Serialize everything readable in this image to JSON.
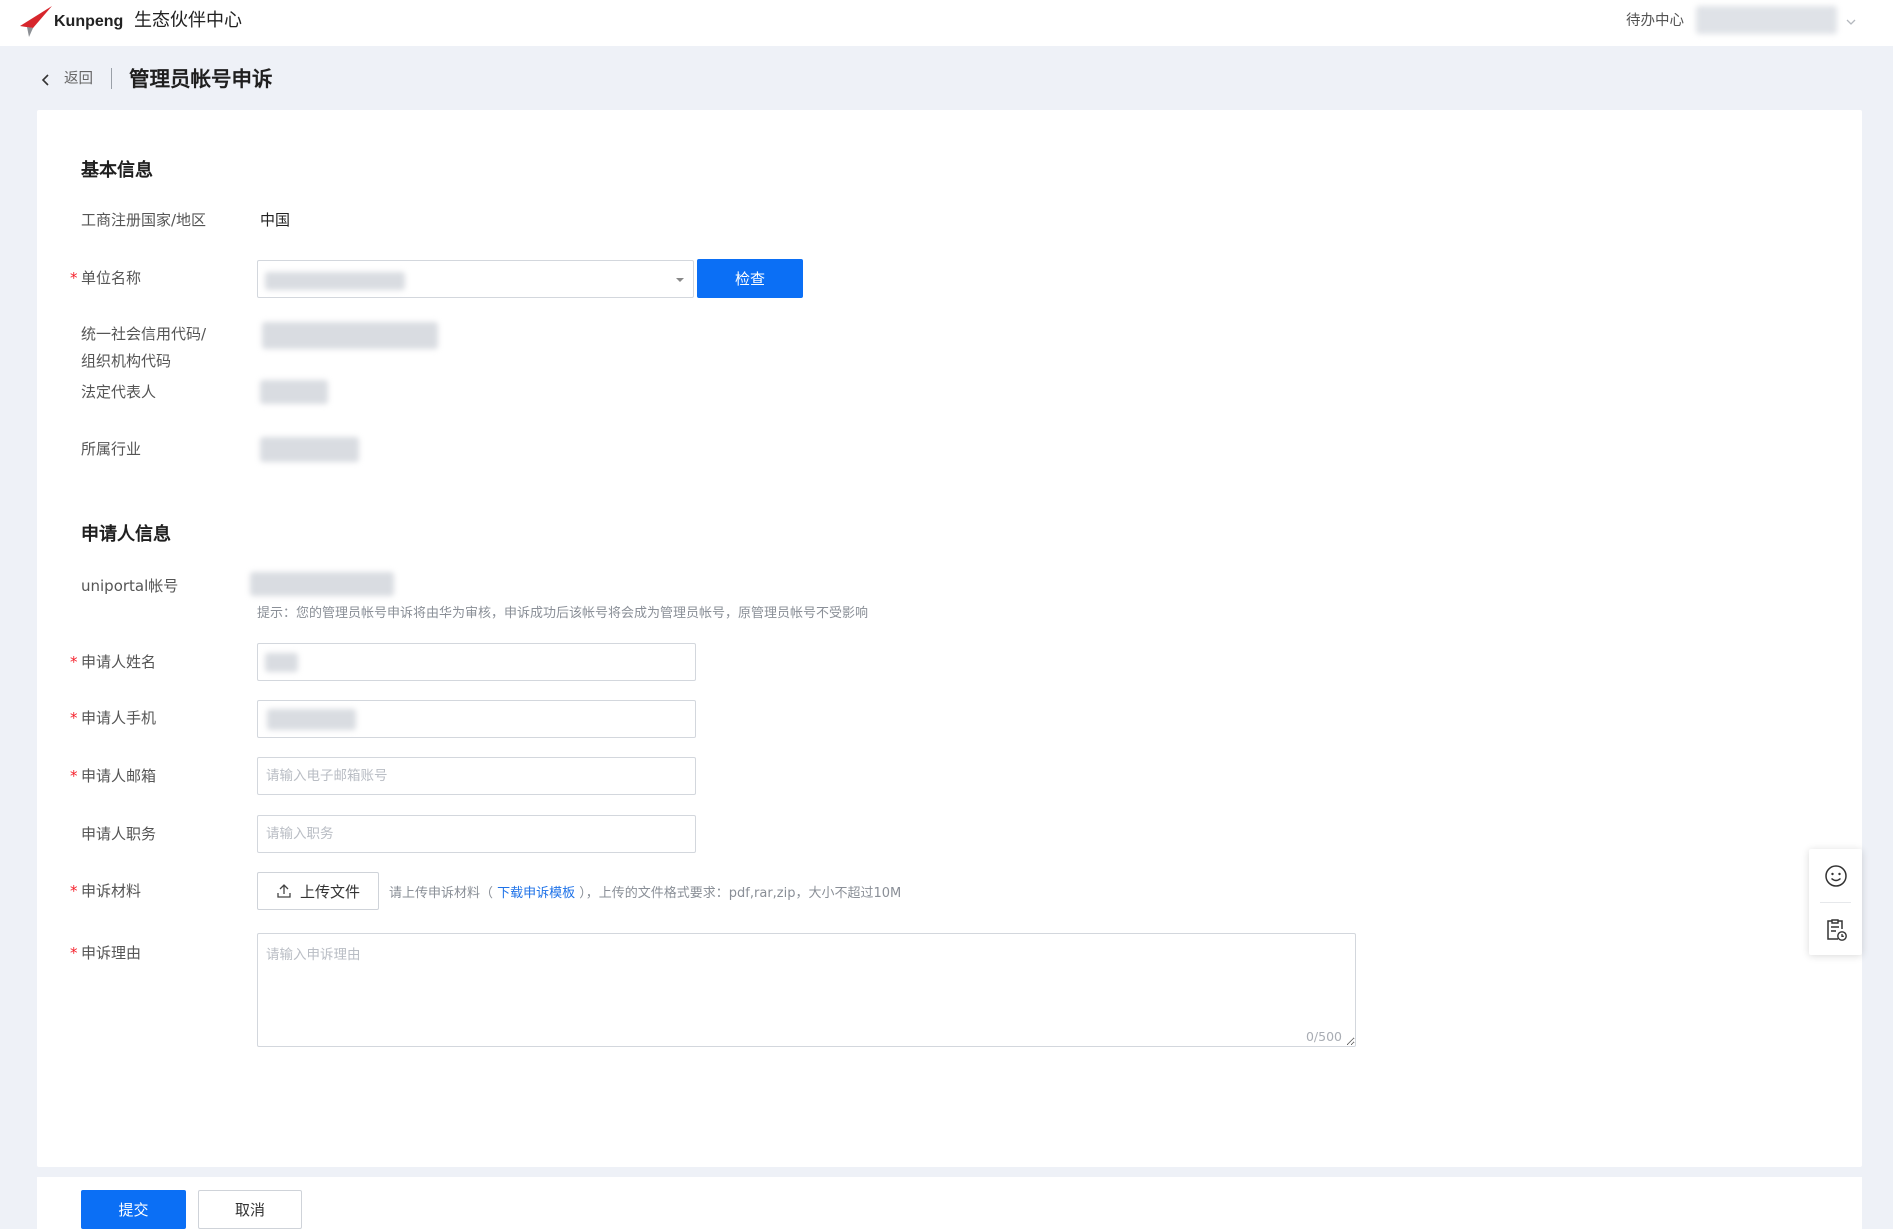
{
  "header": {
    "brand": "Kunpeng",
    "portal_title": "生态伙伴中心",
    "todo_center": "待办中心"
  },
  "breadcrumb": {
    "back_label": "返回",
    "page_title": "管理员帐号申诉"
  },
  "required_mark": "*",
  "basic_info": {
    "section_title": "基本信息",
    "country_label": "工商注册国家/地区",
    "country_value": "中国",
    "company_label": "单位名称",
    "check_button": "检查",
    "credit_code_label_line1": "统一社会信用代码/",
    "credit_code_label_line2": "组织机构代码",
    "legal_rep_label": "法定代表人",
    "industry_label": "所属行业"
  },
  "applicant_info": {
    "section_title": "申请人信息",
    "uniportal_label": "uniportal帐号",
    "hint": "提示：您的管理员帐号申诉将由华为审核，申诉成功后该帐号将会成为管理员帐号，原管理员帐号不受影响",
    "name_label": "申请人姓名",
    "phone_label": "申请人手机",
    "email_label": "申请人邮箱",
    "email_placeholder": "请输入电子邮箱账号",
    "position_label": "申请人职务",
    "position_placeholder": "请输入职务",
    "material_label": "申诉材料",
    "upload_button": "上传文件",
    "material_hint_prefix": "请上传申诉材料（ ",
    "template_link": "下载申诉模板",
    "material_hint_suffix": " ），上传的文件格式要求：pdf,rar,zip，大小不超过10M",
    "reason_label": "申诉理由",
    "reason_placeholder": "请输入申诉理由",
    "reason_counter": "0/500"
  },
  "footer": {
    "submit": "提交",
    "cancel": "取消"
  },
  "colors": {
    "primary": "#0b6ff5",
    "link": "#1e72e8",
    "required": "#f5222d",
    "page_background": "#eef1f7",
    "brand_red": "#d7262c"
  },
  "icons": [
    "brand-logo",
    "chevron-down-icon",
    "chevron-left-icon",
    "caret-down-icon",
    "upload-icon",
    "smiley-icon",
    "feedback-icon"
  ]
}
